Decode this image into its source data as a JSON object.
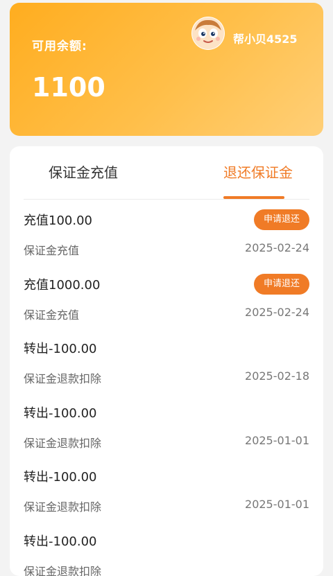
{
  "balance": {
    "label": "可用余额:",
    "amount": "1100"
  },
  "user": {
    "name": "帮小贝4525"
  },
  "tabs": [
    {
      "label": "保证金充值",
      "active": false
    },
    {
      "label": "退还保证金",
      "active": true
    }
  ],
  "colors": {
    "accent": "#f07b26",
    "card_gradient_start": "#ffad1f",
    "card_gradient_end": "#ffcf77"
  },
  "records": [
    {
      "title": "充值100.00",
      "subtitle": "保证金充值",
      "date": "2025-02-24",
      "action_label": "申请退还"
    },
    {
      "title": "充值1000.00",
      "subtitle": "保证金充值",
      "date": "2025-02-24",
      "action_label": "申请退还"
    },
    {
      "title": "转出-100.00",
      "subtitle": "保证金退款扣除",
      "date": "2025-02-18"
    },
    {
      "title": "转出-100.00",
      "subtitle": "保证金退款扣除",
      "date": "2025-01-01"
    },
    {
      "title": "转出-100.00",
      "subtitle": "保证金退款扣除",
      "date": "2025-01-01"
    },
    {
      "title": "转出-100.00",
      "subtitle": "保证金退款扣除",
      "date": ""
    }
  ]
}
